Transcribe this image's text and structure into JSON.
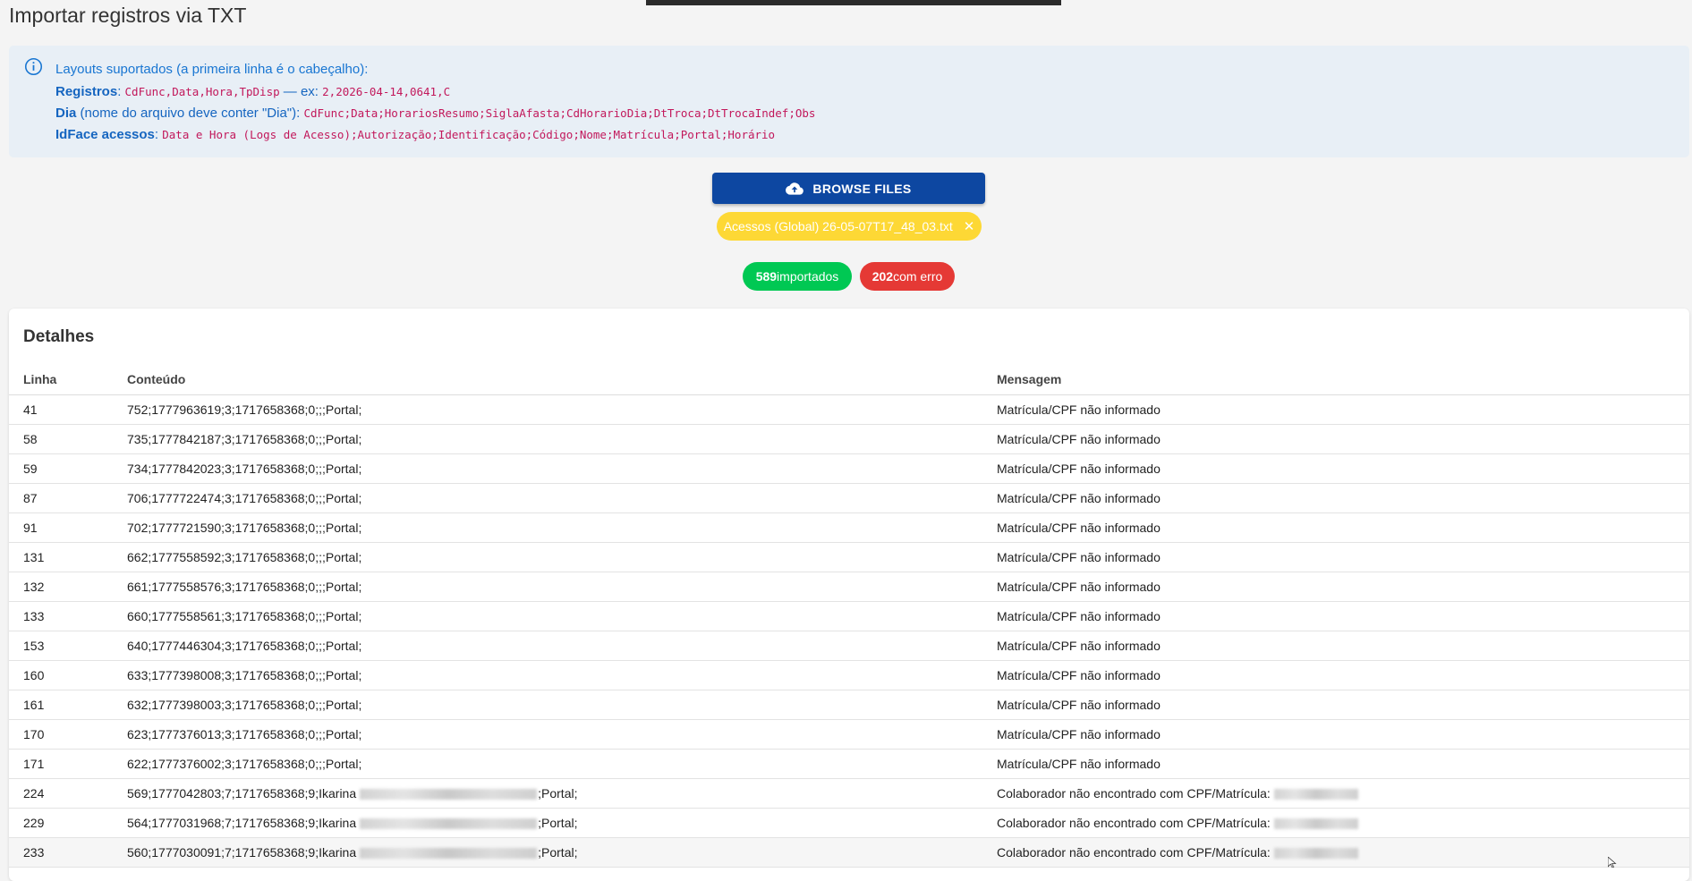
{
  "page": {
    "title": "Importar registros via TXT"
  },
  "info": {
    "icon": "info-circle-icon",
    "intro": "Layouts suportados (a primeira linha é o cabeçalho):",
    "layouts": [
      {
        "label": "Registros",
        "label_rest": "",
        "sep": ": ",
        "format": "CdFunc,Data,Hora,TpDisp",
        "ex_text": " — ex: ",
        "example": "2,2026-04-14,0641,C"
      },
      {
        "label": "Dia",
        "label_rest": " (nome do arquivo deve conter \"Dia\")",
        "sep": ": ",
        "format": "CdFunc;Data;HorariosResumo;SiglaAfasta;CdHorarioDia;DtTroca;DtTrocaIndef;Obs",
        "ex_text": "",
        "example": ""
      },
      {
        "label": "IdFace acessos",
        "label_rest": "",
        "sep": ": ",
        "format": "Data e Hora (Logs de Acesso);Autorização;Identificação;Código;Nome;Matrícula;Portal;Horário",
        "ex_text": "",
        "example": ""
      }
    ]
  },
  "upload": {
    "browse_label": "BROWSE FILES",
    "browse_icon": "cloud-upload-icon",
    "file_name": "Acessos (Global) 26-05-07T17_48_03.txt",
    "remove_glyph": "✕"
  },
  "summary": {
    "imported_count": "589",
    "imported_label": "importados",
    "error_count": "202",
    "error_label": "com erro"
  },
  "details": {
    "title": "Detalhes",
    "columns": [
      "Linha",
      "Conteúdo",
      "Mensagem"
    ],
    "rows": [
      {
        "linha": "41",
        "conteudo": "752;1777963619;3;1717658368;0;;;Portal;",
        "mensagem": "Matrícula/CPF não informado"
      },
      {
        "linha": "58",
        "conteudo": "735;1777842187;3;1717658368;0;;;Portal;",
        "mensagem": "Matrícula/CPF não informado"
      },
      {
        "linha": "59",
        "conteudo": "734;1777842023;3;1717658368;0;;;Portal;",
        "mensagem": "Matrícula/CPF não informado"
      },
      {
        "linha": "87",
        "conteudo": "706;1777722474;3;1717658368;0;;;Portal;",
        "mensagem": "Matrícula/CPF não informado"
      },
      {
        "linha": "91",
        "conteudo": "702;1777721590;3;1717658368;0;;;Portal;",
        "mensagem": "Matrícula/CPF não informado"
      },
      {
        "linha": "131",
        "conteudo": "662;1777558592;3;1717658368;0;;;Portal;",
        "mensagem": "Matrícula/CPF não informado"
      },
      {
        "linha": "132",
        "conteudo": "661;1777558576;3;1717658368;0;;;Portal;",
        "mensagem": "Matrícula/CPF não informado"
      },
      {
        "linha": "133",
        "conteudo": "660;1777558561;3;1717658368;0;;;Portal;",
        "mensagem": "Matrícula/CPF não informado"
      },
      {
        "linha": "153",
        "conteudo": "640;1777446304;3;1717658368;0;;;Portal;",
        "mensagem": "Matrícula/CPF não informado"
      },
      {
        "linha": "160",
        "conteudo": "633;1777398008;3;1717658368;0;;;Portal;",
        "mensagem": "Matrícula/CPF não informado"
      },
      {
        "linha": "161",
        "conteudo": "632;1777398003;3;1717658368;0;;;Portal;",
        "mensagem": "Matrícula/CPF não informado"
      },
      {
        "linha": "170",
        "conteudo": "623;1777376013;3;1717658368;0;;;Portal;",
        "mensagem": "Matrícula/CPF não informado"
      },
      {
        "linha": "171",
        "conteudo": "622;1777376002;3;1717658368;0;;;Portal;",
        "mensagem": "Matrícula/CPF não informado"
      },
      {
        "linha": "224",
        "conteudo": "569;1777042803;7;1717658368;9;Ikarina",
        "conteudo_tail": ";Portal;",
        "mensagem": "Colaborador não encontrado com CPF/Matrícula:"
      },
      {
        "linha": "229",
        "conteudo": "564;1777031968;7;1717658368;9;Ikarina",
        "conteudo_tail": ";Portal;",
        "mensagem": "Colaborador não encontrado com CPF/Matrícula:"
      },
      {
        "linha": "233",
        "conteudo": "560;1777030091;7;1717658368;9;Ikarina",
        "conteudo_tail": ";Portal;",
        "mensagem": "Colaborador não encontrado com CPF/Matrícula:"
      }
    ]
  }
}
